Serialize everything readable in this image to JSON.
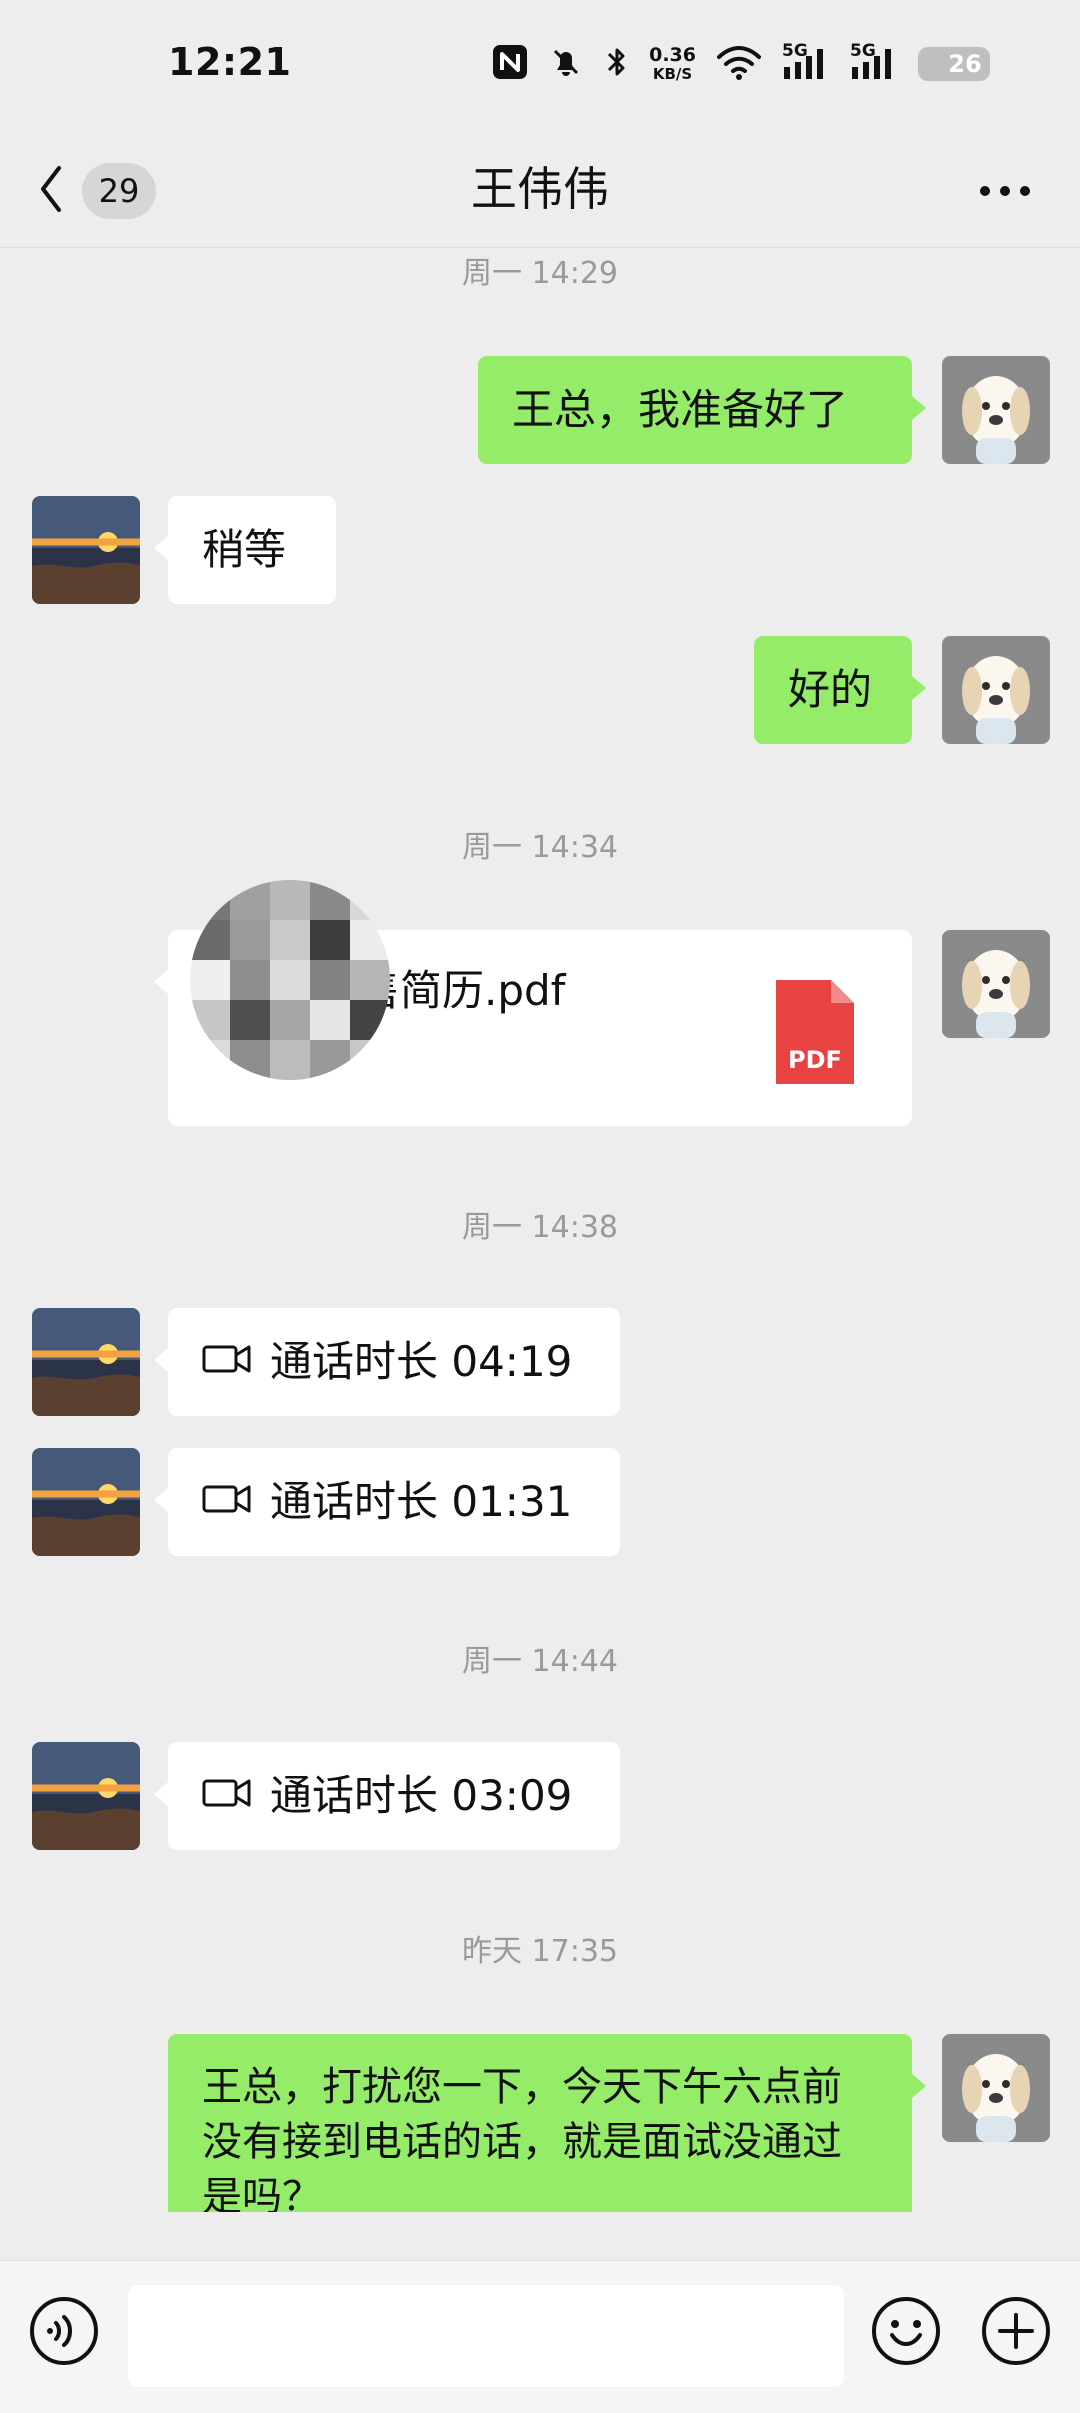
{
  "status_bar": {
    "time": "12:21",
    "network_speed_value": "0.36",
    "network_speed_unit": "KB/S",
    "network_1": "5G",
    "network_2": "5G",
    "battery": "26"
  },
  "header": {
    "back_count": "29",
    "contact_name": "王伟伟"
  },
  "messages": [
    {
      "type": "time",
      "text": "周一 14:29"
    },
    {
      "type": "sent_text",
      "text": "王总，我准备好了"
    },
    {
      "type": "received_text",
      "text": "稍等"
    },
    {
      "type": "sent_text",
      "text": "好的"
    },
    {
      "type": "time",
      "text": "周一 14:34"
    },
    {
      "type": "file",
      "filename_visible": "网络销售简历.pdf",
      "icon_label": "PDF"
    },
    {
      "type": "time",
      "text": "周一 14:38"
    },
    {
      "type": "video_call",
      "text": "通话时长 04:19"
    },
    {
      "type": "video_call",
      "text": "通话时长 01:31"
    },
    {
      "type": "time",
      "text": "周一 14:44"
    },
    {
      "type": "video_call",
      "text": "通话时长 03:09"
    },
    {
      "type": "time",
      "text": "昨天 17:35"
    },
    {
      "type": "sent_text",
      "text": "王总，打扰您一下，今天下午六点前没有接到电话的话，就是面试没通过是吗？"
    }
  ],
  "input": {
    "value": "",
    "placeholder": ""
  },
  "colors": {
    "background": "#ededed",
    "sent_bubble": "#95ec69",
    "received_bubble": "#ffffff",
    "timestamp_text": "#9a9a9a",
    "pdf_red": "#e94242"
  },
  "icons": {
    "back": "chevron-left-icon",
    "more": "more-icon",
    "video_call": "video-camera-icon",
    "voice": "voice-icon",
    "emoji": "emoji-icon",
    "plus": "plus-icon",
    "pdf": "pdf-file-icon"
  }
}
